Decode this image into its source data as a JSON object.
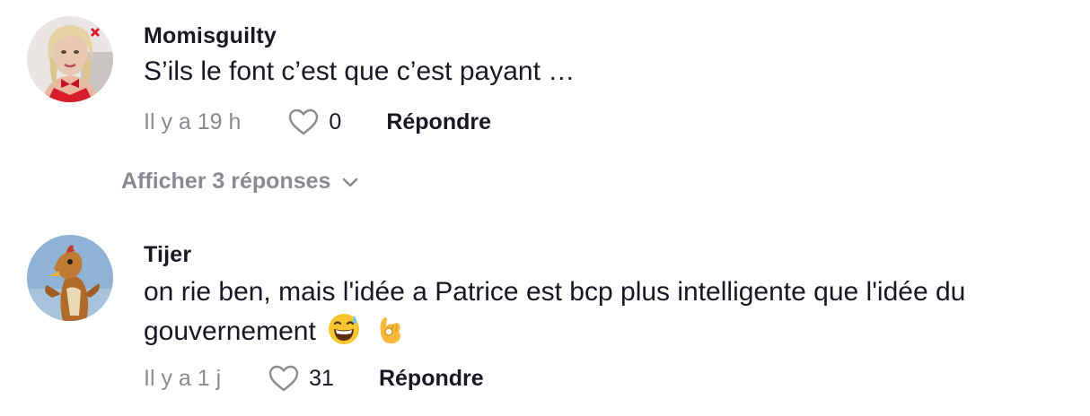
{
  "comments": [
    {
      "username": "Momisguilty",
      "text": "S’ils le font c’est que c’est payant …",
      "time": "Il y a 19 h",
      "likes": "0",
      "reply_label": "Répondre"
    },
    {
      "username": "Tijer",
      "text": "on rie ben, mais l'idée a Patrice est bcp plus intelligente que l'idée du gouvernement",
      "time": "Il y a 1 j",
      "likes": "31",
      "reply_label": "Répondre"
    }
  ],
  "view_replies_label": "Afficher 3 réponses",
  "icons": {
    "like": "heart-outline-icon",
    "expand": "chevron-down-icon",
    "emoji_1": "grinning-face-with-sweat-emoji",
    "emoji_2": "ok-hand-emoji"
  },
  "colors": {
    "primary_text": "#161823",
    "secondary_text": "#8a8b91"
  }
}
